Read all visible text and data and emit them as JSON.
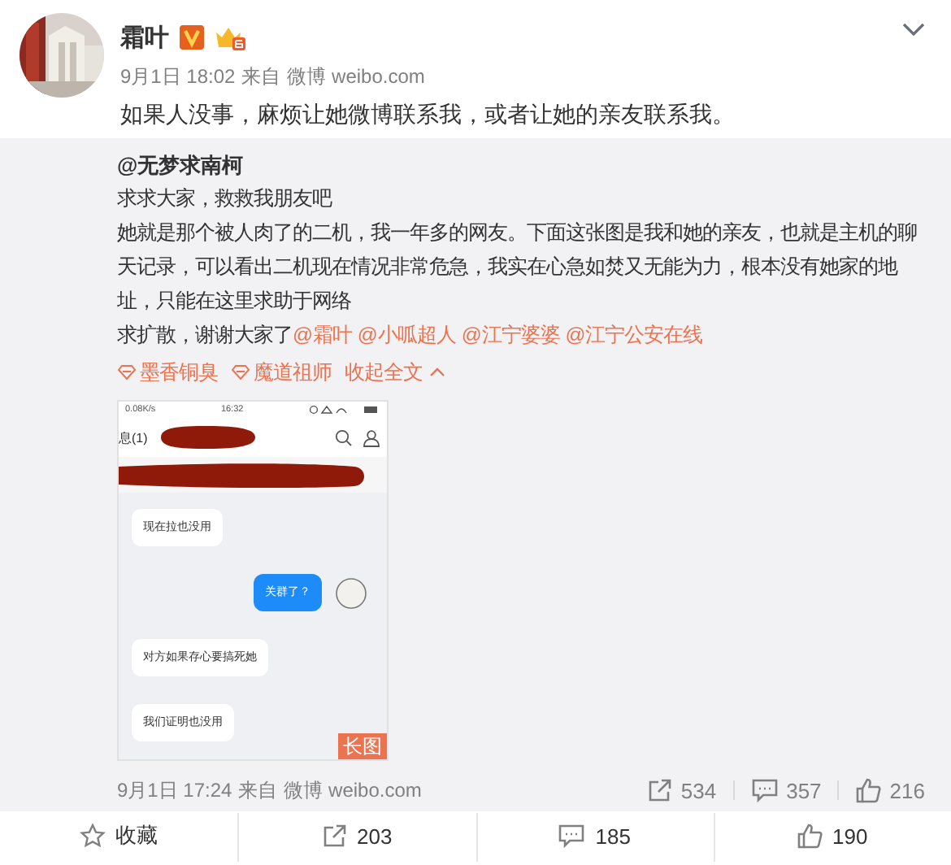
{
  "post": {
    "author": "霜叶",
    "verified": true,
    "time": "9月1日 18:02",
    "from": "来自",
    "source": "微博 weibo.com",
    "text": "如果人没事，麻烦让她微博联系我，或者让她的亲友联系我。"
  },
  "repost": {
    "author": "@无梦求南柯",
    "paragraphs": [
      "求求大家，救救我朋友吧",
      "她就是那个被人肉了的二机，我一年多的网友。下面这张图是我和她的亲友，也就是主机的聊天记录，可以看出二机现在情况非常危急，我实在心急如焚又无能为力，根本没有她家的地址，只能在这里求助于网络"
    ],
    "last_line": {
      "text": "求扩散，谢谢大家了",
      "mentions": [
        "@霜叶",
        "@小呱超人",
        "@江宁婆婆",
        "@江宁公安在线"
      ]
    },
    "tags": [
      "墨香铜臭",
      "魔道祖师"
    ],
    "collapse": "收起全文",
    "image": {
      "net_speed": "0.08K/s",
      "clock": "16:32",
      "title": "息(1)",
      "messages": [
        {
          "text": "现在拉也没用",
          "kind": "incoming"
        },
        {
          "text": "关群了？",
          "kind": "outgoing"
        },
        {
          "text": "对方如果存心要搞死她",
          "kind": "incoming"
        },
        {
          "text": "我们证明也没用",
          "kind": "incoming"
        }
      ],
      "badge": "长图"
    },
    "time": "9月1日 17:24",
    "from": "来自",
    "source": "微博 weibo.com",
    "stats": [
      {
        "kind": "repost",
        "count": "534"
      },
      {
        "kind": "comment",
        "count": "357"
      },
      {
        "kind": "like",
        "count": "216"
      }
    ]
  },
  "actions": [
    {
      "kind": "favorite",
      "label": "收藏"
    },
    {
      "kind": "repost",
      "label": "203"
    },
    {
      "kind": "comment",
      "label": "185"
    },
    {
      "kind": "like",
      "label": "190"
    }
  ]
}
